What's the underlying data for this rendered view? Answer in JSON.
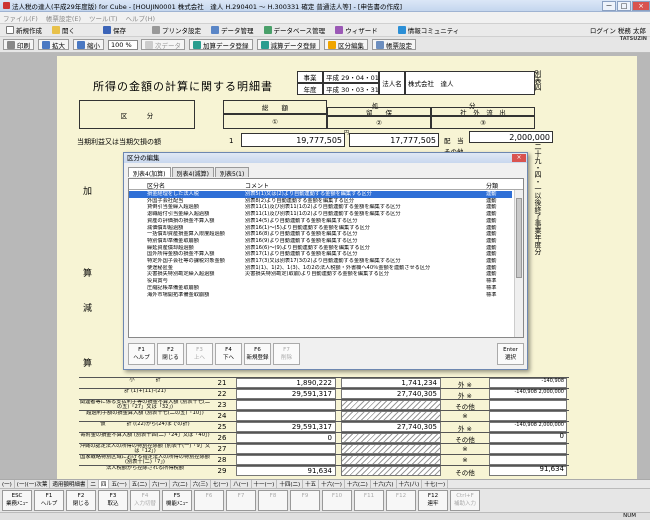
{
  "window": {
    "title": "法人税の達人(平成29年度版) for Cube - [HOUJIN0001 株式会社　達人 H.290401 ～ H.300331 確定 普通法人等] - [申告書の作成]",
    "minimize": "－",
    "maximize": "□",
    "close": "×"
  },
  "menu": [
    "ファイル(F)",
    "帳票設定(E)",
    "ツール(T)",
    "ヘルプ(H)"
  ],
  "toolbar1": {
    "items": [
      "新規作成",
      "開く",
      "保存",
      "プリンタ設定",
      "データ管理",
      "データベース管理",
      "ウィザード",
      "情報コミュニティ"
    ],
    "right": "ログイン 税務 太郎"
  },
  "toolbar2": {
    "items": [
      "印刷",
      "拡大",
      "縮小",
      "次データ",
      "加算データ登録",
      "減算データ登録",
      "区分編集",
      "帳票設定"
    ],
    "zoom": "100 %"
  },
  "logo": "TATSUZIN",
  "form": {
    "title": "所得の金額の計算に関する明細書",
    "period_label_1": "事業",
    "period_label_2": "年度",
    "period_from": "平成 29・04・01",
    "period_to": "平成 30・03・31",
    "corp_label": "法人名",
    "corp_name": "株式会社　達人",
    "side_label_1": "別表四",
    "side_label_2": "平二十九・四・一以後終了事業年度分",
    "col_kubun": "区　　　分",
    "col_total": "総　　額",
    "col_circ1": "①",
    "col_shobun": "処",
    "col_bun": "分",
    "col_ryuho": "留　　保",
    "col_circ2": "②",
    "col_shagai": "社　外　流　出",
    "col_circ3": "③",
    "yen": "円",
    "first_row_label": "当期利益又は当期欠損の額",
    "first_row_num": "1",
    "first_row_total": "19,777,505",
    "first_row_ryuho": "17,777,505",
    "haito": "配　当",
    "haito_value": "2,000,000",
    "sonota": "その他",
    "vert_ka": "加",
    "vert_san": "算",
    "vert_gen": "減",
    "vert_san2": "算"
  },
  "rows": [
    {
      "label": "小　　　　計",
      "num": "21",
      "v1": "1,890,222",
      "v2": "1,741,234",
      "cat": "外 ※",
      "v3": "-140,908"
    },
    {
      "label": "計 (1)+(11)-(21)",
      "num": "22",
      "v1": "29,591,317",
      "v2": "27,740,305",
      "cat": "外 ※",
      "v3": "-140,908 2,000,000"
    },
    {
      "label": "関連者等に係る支払利子等の損金不算入額 (別表十七(二の五)「27」又は「32」)",
      "num": "23",
      "v1": "",
      "v2": "",
      "cat": "その他",
      "v3": ""
    },
    {
      "label": "超過利子額の損金算入額 (別表十七(二の五)「10」)",
      "num": "24",
      "v1": "",
      "v2": "",
      "cat": "※",
      "v3": ""
    },
    {
      "label": "仮　　　　計 ((22)から(24)までの計)",
      "num": "25",
      "v1": "29,591,317",
      "v2": "27,740,305",
      "cat": "外 ※",
      "v3": "-140,908 2,000,000"
    },
    {
      "label": "寄附金の損金不算入額 (別表十四(二)「24」又は「40」)",
      "num": "26",
      "v1": "0",
      "v2": "",
      "cat": "その他",
      "v3": "0"
    },
    {
      "label": "沖縄の認定法人の所得の特別控除額 (別表十(一)「9」又は「12」)",
      "num": "27",
      "v1": "",
      "v2": "",
      "cat": "※",
      "v3": ""
    },
    {
      "label": "国家戦略特別区域における指定法人の所得の特別控除額 (別表十(二)「7」)",
      "num": "28",
      "v1": "",
      "v2": "",
      "cat": "※",
      "v3": ""
    },
    {
      "label": "法人税額から控除される所得税額",
      "num": "29",
      "v1": "91,634",
      "v2": "",
      "cat": "その他",
      "v3": "91,634"
    }
  ],
  "dialog": {
    "title": "区分の編集",
    "close": "×",
    "tabs": [
      "別表4(加算)",
      "別表4(減算)",
      "別表5(1)"
    ],
    "headers": {
      "name": "区分名",
      "comment": "コメント",
      "type": "分類"
    },
    "items": [
      {
        "name": "損金経理をした法人税",
        "comment": "別表5(1)又は(2)より自動連動する金額を編集する区分",
        "type": "連動"
      },
      {
        "name": "外国子会社配当",
        "comment": "別表8(2)より自動連動する金額を編集する区分",
        "type": "連動"
      },
      {
        "name": "貸倒引当金繰入超過額",
        "comment": "別表11(1)及び別表11(1の2)より自動連動する金額を編集する区分",
        "type": "連動"
      },
      {
        "name": "退職給付引当金繰入超過額",
        "comment": "別表11(1)及び別表11(1の2)より自動連動する金額を編集する区分",
        "type": "連動"
      },
      {
        "name": "資産の評価損の損金不算入額",
        "comment": "別表14(5)より自動連動する金額を編集する区分",
        "type": "連動"
      },
      {
        "name": "減価償却超過額",
        "comment": "別表16(1)～(5)より自動連動する金額を編集する区分",
        "type": "連動"
      },
      {
        "name": "一括償却資産損金算入限度超過額",
        "comment": "別表16(8)より自動連動する金額を編集する区分",
        "type": "連動"
      },
      {
        "name": "特別償却準備金取崩額",
        "comment": "別表16(9)より自動連動する金額を編集する区分",
        "type": "連動"
      },
      {
        "name": "繰延資産償却超過額",
        "comment": "別表16(6)～(9)より自動連動する金額を編集する区分",
        "type": "連動"
      },
      {
        "name": "国外所得金額の損金不算入額",
        "comment": "別表17(1)より自動連動する金額を編集する区分",
        "type": "連動"
      },
      {
        "name": "特定外国子会社等の課税対象金額",
        "comment": "別表17(3)又は別表17(3の2)より自動連動する金額を編集する区分",
        "type": "連動"
      },
      {
        "name": "使途秘匿金",
        "comment": "別表1(1)、1(2)、1(3)、1の2の法人税額・外書欄へ40％金額を連動させる区分",
        "type": "連動"
      },
      {
        "name": "災害損失特別勘定繰入超過額",
        "comment": "災害損失特別勘定(取崩)より自動連動する金額を編集する区分",
        "type": "連動"
      },
      {
        "name": "役員賞与",
        "comment": "",
        "type": "標準"
      },
      {
        "name": "圧縮記帳準備金取崩額",
        "comment": "",
        "type": "標準"
      },
      {
        "name": "海外市場開拓準備金取崩額",
        "comment": "",
        "type": "標準"
      }
    ],
    "keys": [
      {
        "f": "F1",
        "label": "ヘルプ",
        "enabled": true
      },
      {
        "f": "F2",
        "label": "閉じる",
        "enabled": true
      },
      {
        "f": "F3",
        "label": "上へ",
        "enabled": false
      },
      {
        "f": "F4",
        "label": "下へ",
        "enabled": true
      },
      {
        "f": "F6",
        "label": "新規登録",
        "enabled": true
      },
      {
        "f": "F7",
        "label": "削除",
        "enabled": false
      },
      {
        "f": "Enter",
        "label": "選択",
        "enabled": true
      }
    ]
  },
  "pagetabs": [
    "(一)",
    "(一)(一)次葉",
    "適用額明細書",
    "二",
    "四",
    "五(一)",
    "五(二)",
    "六(一)",
    "六(二)",
    "六(三)",
    "七(一)",
    "八(一)",
    "十一(一)",
    "十四(二)",
    "十五",
    "十六(一)",
    "十六(二)",
    "十六(六)",
    "十六(八)",
    "十七(一)"
  ],
  "fkeys": [
    {
      "f": "ESC",
      "label": "業務ﾒﾆｭｰ",
      "enabled": true
    },
    {
      "f": "F1",
      "label": "ヘルプ",
      "enabled": true
    },
    {
      "f": "F2",
      "label": "閉じる",
      "enabled": true
    },
    {
      "f": "F3",
      "label": "取込",
      "enabled": true
    },
    {
      "f": "F4",
      "label": "入力切替",
      "enabled": false
    },
    {
      "f": "F5",
      "label": "機能ﾒﾆｭｰ",
      "enabled": true
    },
    {
      "f": "F6",
      "label": "",
      "enabled": false
    },
    {
      "f": "F7",
      "label": "",
      "enabled": false
    },
    {
      "f": "F8",
      "label": "",
      "enabled": false
    },
    {
      "f": "F9",
      "label": "",
      "enabled": false
    },
    {
      "f": "F10",
      "label": "",
      "enabled": false
    },
    {
      "f": "F11",
      "label": "",
      "enabled": false
    },
    {
      "f": "F12",
      "label": "",
      "enabled": false
    },
    {
      "f": "F12",
      "label": "連牢",
      "enabled": true
    },
    {
      "f": "Ctrl+F",
      "label": "補助入力",
      "enabled": false
    }
  ],
  "status": "NUM"
}
